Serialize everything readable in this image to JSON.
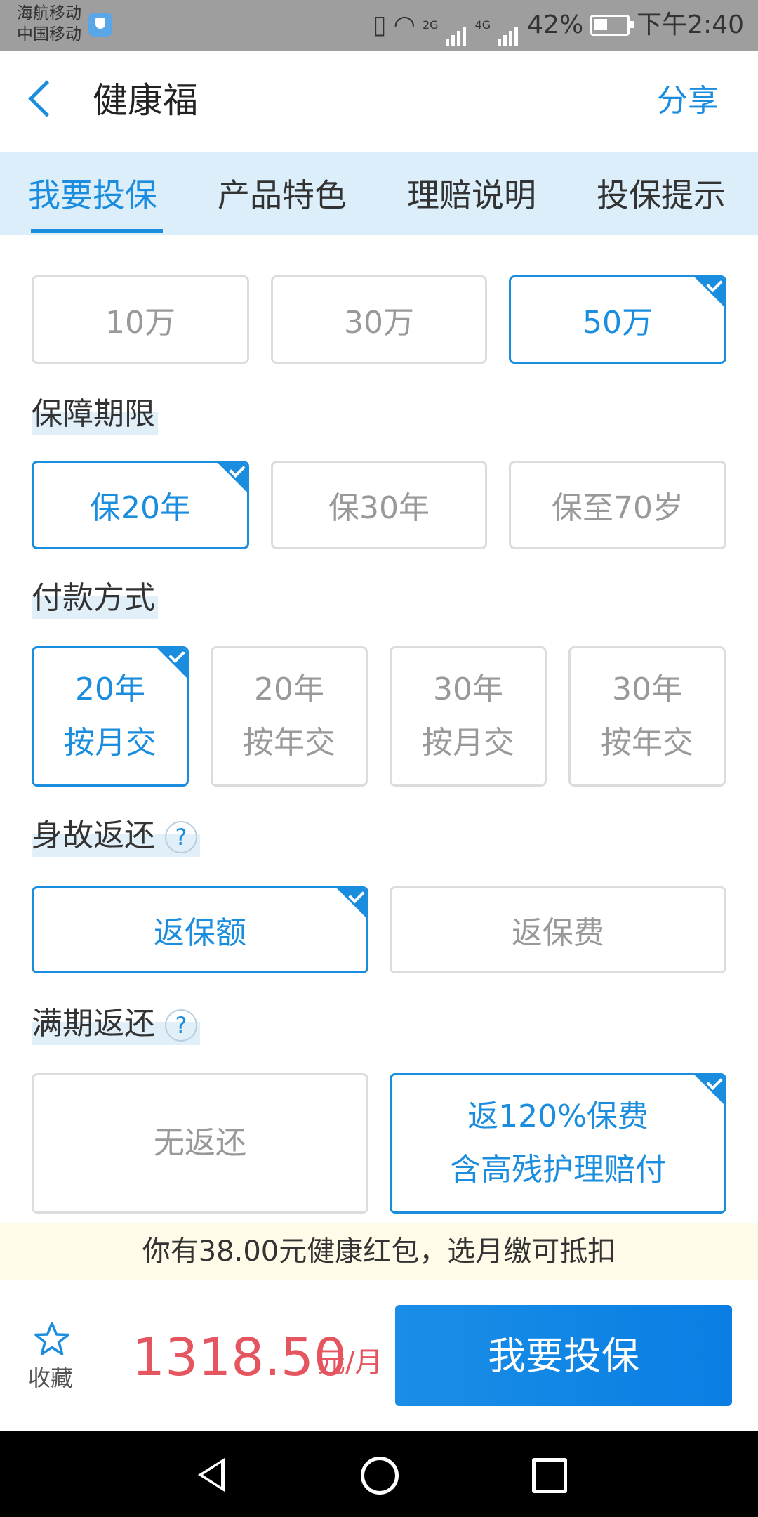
{
  "status_bar": {
    "carrier_1": "海航移动",
    "carrier_2": "中国移动",
    "net_2g": "2G",
    "net_4g": "4G",
    "battery": "42%",
    "time": "下午2:40"
  },
  "header": {
    "title": "健康福",
    "share": "分享"
  },
  "tabs": [
    {
      "label": "我要投保",
      "active": true
    },
    {
      "label": "产品特色"
    },
    {
      "label": "理赔说明"
    },
    {
      "label": "投保提示"
    }
  ],
  "sections": {
    "coverage_amount": {
      "options": [
        "10万",
        "30万",
        "50万"
      ],
      "selected": "50万"
    },
    "coverage_period": {
      "label": "保障期限",
      "options": [
        "保20年",
        "保30年",
        "保至70岁"
      ],
      "selected": "保20年"
    },
    "payment_method": {
      "label": "付款方式",
      "options": [
        {
          "line1": "20年",
          "line2": "按月交"
        },
        {
          "line1": "20年",
          "line2": "按年交"
        },
        {
          "line1": "30年",
          "line2": "按月交"
        },
        {
          "line1": "30年",
          "line2": "按年交"
        }
      ],
      "selected_index": 0
    },
    "death_return": {
      "label": "身故返还",
      "help": "?",
      "options": [
        "返保额",
        "返保费"
      ],
      "selected": "返保额"
    },
    "maturity_return": {
      "label": "满期返还",
      "help": "?",
      "options": [
        {
          "line1": "无返还",
          "line2": ""
        },
        {
          "line1": "返120%保费",
          "line2": "含高残护理赔付"
        }
      ],
      "selected_index": 1
    }
  },
  "promo": "你有38.00元健康红包，选月缴可抵扣",
  "bottom": {
    "favorite_label": "收藏",
    "price": "1318.50",
    "price_unit": "元/月",
    "buy_button": "我要投保"
  },
  "colors": {
    "accent": "#1a8ddf",
    "price": "#e5555f",
    "tab_bg": "#dbeef9",
    "promo_bg": "#fffbe8"
  }
}
